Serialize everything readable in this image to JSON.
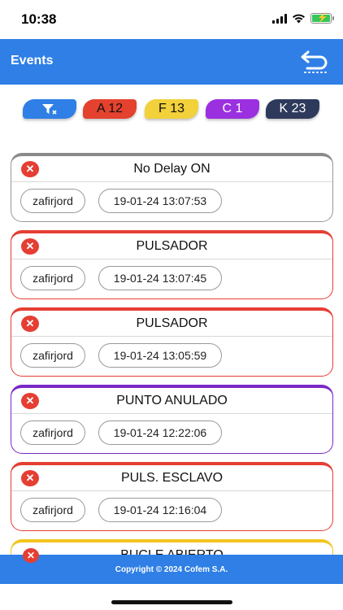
{
  "status_bar": {
    "time": "10:38"
  },
  "header": {
    "title": "Events"
  },
  "filters": [
    {
      "id": "filter",
      "label": "",
      "color": "#2f7fe6"
    },
    {
      "id": "a",
      "label": "A 12",
      "color": "#e4412e"
    },
    {
      "id": "f",
      "label": "F 13",
      "color": "#f2d13a"
    },
    {
      "id": "c",
      "label": "C 1",
      "color": "#9b30e0"
    },
    {
      "id": "k",
      "label": "K 23",
      "color": "#2d3a5c"
    }
  ],
  "events": [
    {
      "title": "No Delay ON",
      "user": "zafirjord",
      "datetime": "19-01-24 13:07:53",
      "color": "#8a8a8a"
    },
    {
      "title": "PULSADOR",
      "user": "zafirjord",
      "datetime": "19-01-24 13:07:45",
      "color": "#e53e33"
    },
    {
      "title": "PULSADOR",
      "user": "zafirjord",
      "datetime": "19-01-24 13:05:59",
      "color": "#e53e33"
    },
    {
      "title": "PUNTO ANULADO",
      "user": "zafirjord",
      "datetime": "19-01-24 12:22:06",
      "color": "#7a28c8"
    },
    {
      "title": "PULS. ESCLAVO",
      "user": "zafirjord",
      "datetime": "19-01-24 12:16:04",
      "color": "#e53e33"
    },
    {
      "title": "BUCLE ABIERTO",
      "user": "",
      "datetime": "",
      "color": "#f2c51d"
    }
  ],
  "footer": {
    "text": "Copyright © 2024 Cofem S.A."
  }
}
